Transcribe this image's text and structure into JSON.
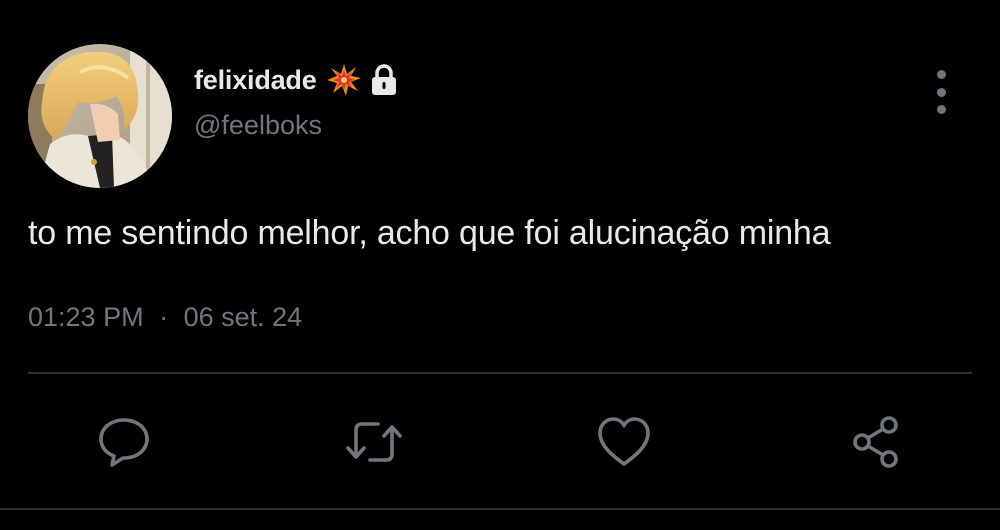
{
  "user": {
    "display_name": "felixidade",
    "handle": "@feelboks",
    "emoji": "collision-emoji",
    "protected_icon": "lock-icon"
  },
  "tweet": {
    "text": "to me sentindo melhor, acho que foi alucinação minha",
    "time": "01:23 PM",
    "separator": "·",
    "date": "06 set. 24"
  },
  "actions": [
    {
      "name": "reply",
      "icon": "speech-bubble-icon"
    },
    {
      "name": "retweet",
      "icon": "retweet-icon"
    },
    {
      "name": "like",
      "icon": "heart-icon"
    },
    {
      "name": "share",
      "icon": "share-icon"
    }
  ],
  "colors": {
    "background": "#000000",
    "primary_text": "#e7e9ea",
    "secondary_text": "#71767b",
    "divider": "#2f3336"
  }
}
